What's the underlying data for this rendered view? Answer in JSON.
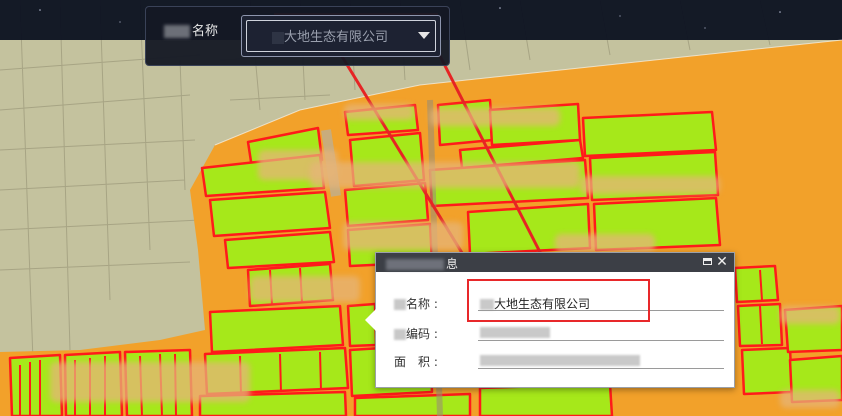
{
  "selector": {
    "label": "名称",
    "value": "大地生态有限公司",
    "arrow_icon": "triangle-down-icon"
  },
  "popup": {
    "title": "息",
    "maximize_icon": "window-maximize-icon",
    "close_icon": "close-icon",
    "fields": [
      {
        "label": "名称 :",
        "value": "大地生态有限公司"
      },
      {
        "label": "编码 :",
        "value": ""
      },
      {
        "label": "面　积 :",
        "value": ""
      }
    ]
  },
  "map": {
    "colors": {
      "orange_zone": "#f2a12a",
      "field_fill": "#a6e81a",
      "field_border": "#ff1a1a",
      "basemap": "#c9c7a6",
      "highlight_red": "#e8282a"
    }
  }
}
